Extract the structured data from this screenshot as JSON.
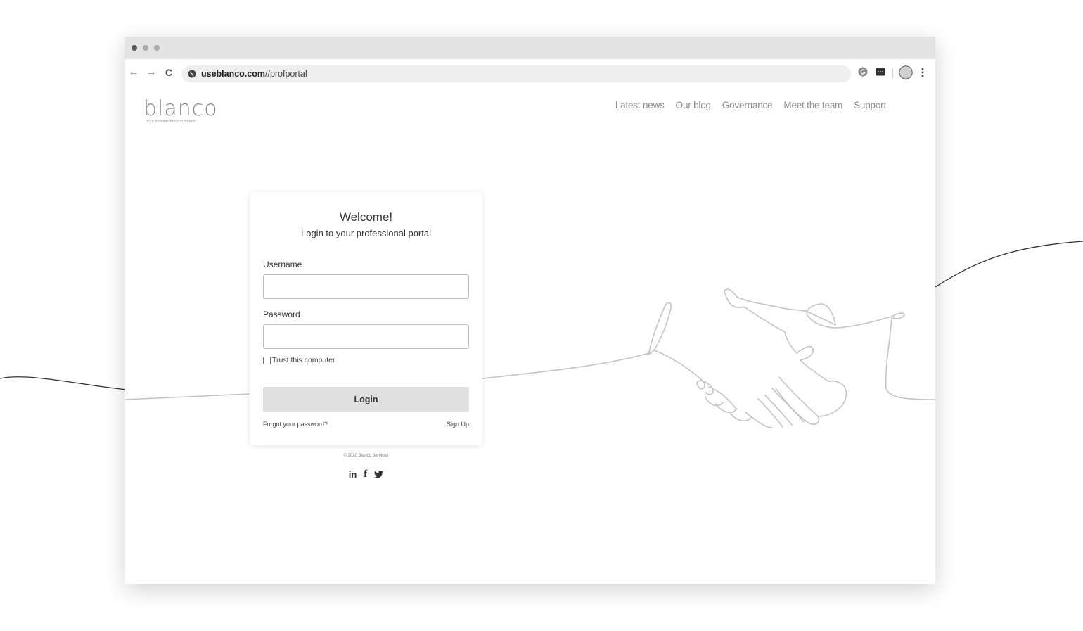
{
  "browser": {
    "url_domain": "useblanco.com",
    "url_path": "//profportal",
    "back_icon": "←",
    "forward_icon": "→",
    "reload_icon": "C"
  },
  "site": {
    "logo_text": "blanco",
    "logo_tagline": "Your invisible force in fintech",
    "nav": [
      "Latest news",
      "Our blog",
      "Governance",
      "Meet the team",
      "Support"
    ]
  },
  "login": {
    "title": "Welcome!",
    "subtitle": "Login to your professional portal",
    "username_label": "Username",
    "username_value": "",
    "password_label": "Password",
    "password_value": "",
    "trust_label": "Trust this computer",
    "trust_checked": false,
    "login_button": "Login",
    "forgot_link": "Forgot your password?",
    "signup_link": "Sign Up"
  },
  "footer": {
    "copyright": "© 2020 Blanco Services",
    "social": [
      "in",
      "f",
      "🐦"
    ]
  },
  "colors": {
    "accent_gray": "#e0e0e0",
    "nav_text": "#8c8c8c",
    "line": "#333333"
  }
}
